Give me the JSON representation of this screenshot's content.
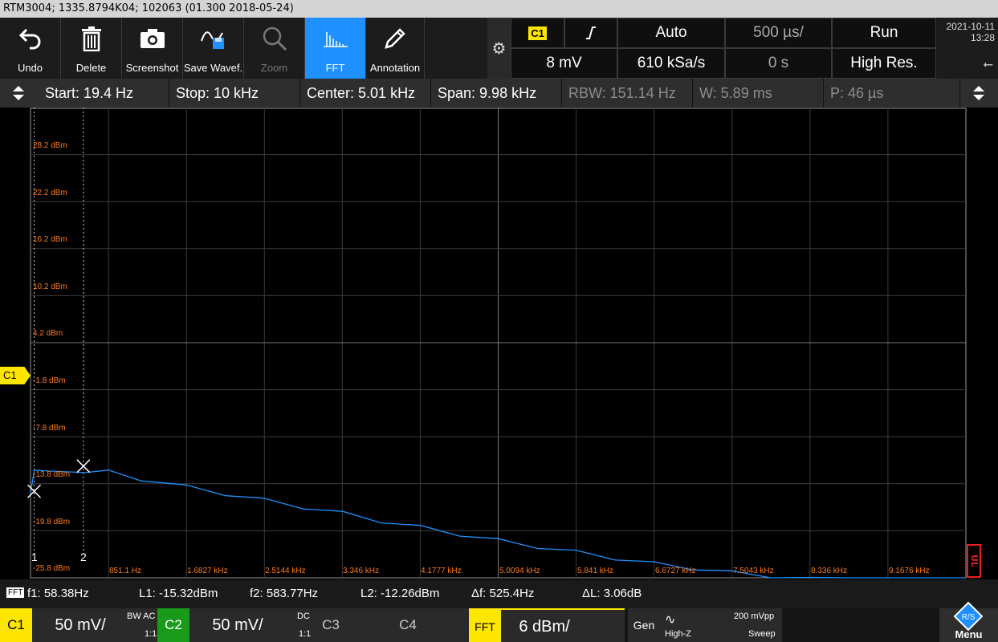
{
  "title": "RTM3004; 1335.8794K04; 102063 (01.300 2018-05-24)",
  "toolbar": {
    "undo": "Undo",
    "delete": "Delete",
    "screenshot": "Screenshot",
    "save_waveform": "Save Wavef.",
    "zoom": "Zoom",
    "fft": "FFT",
    "annotation": "Annotation"
  },
  "acquisition": {
    "channel": "C1",
    "trigger_slope": "rising-edge-icon",
    "trigger_mode": "Auto",
    "timebase": "500 µs/",
    "run_state": "Run",
    "trigger_level": "8 mV",
    "sample_rate": "610 kSa/s",
    "horizontal_position": "0 s",
    "acq_mode": "High Res."
  },
  "datetime": {
    "date": "2021-10-11",
    "time": "13:28"
  },
  "fft_settings": {
    "start": "Start: 19.4 Hz",
    "stop": "Stop: 10 kHz",
    "center": "Center: 5.01 kHz",
    "span": "Span: 9.98 kHz",
    "rbw": "RBW: 151.14 Hz",
    "window": "W: 5.89 ms",
    "period": "P: 46 µs"
  },
  "plot": {
    "y_labels": [
      "28.2 dBm",
      "22.2 dBm",
      "16.2 dBm",
      "10.2 dBm",
      "4.2 dBm",
      "-1.8 dBm",
      "-7.8 dBm",
      "-13.8 dBm",
      "-19.8 dBm",
      "-25.8 dBm"
    ],
    "x_labels": [
      "851.1 Hz",
      "1.6827 kHz",
      "2.5144 kHz",
      "3.346 kHz",
      "4.1777 kHz",
      "5.0094 kHz",
      "5.841 kHz",
      "6.6727 kHz",
      "7.5043 kHz",
      "8.336 kHz",
      "9.1676 kHz"
    ],
    "channel_marker": "C1",
    "cursor1": "1",
    "cursor2": "2",
    "ul_marker": "UL",
    "trace_color": "#1e90ff",
    "label_color": "#ff7a1a"
  },
  "chart_data": {
    "type": "line",
    "title": "",
    "xlabel": "",
    "ylabel": "",
    "x_unit": "kHz",
    "y_unit": "dBm",
    "xlim": [
      0.0194,
      10
    ],
    "ylim": [
      -25.8,
      31.2
    ],
    "grid": true,
    "series": [
      {
        "x": [
          0.0194,
          0.06,
          0.2,
          0.4,
          0.6,
          0.851,
          1.2,
          1.68,
          2.1,
          2.51,
          2.93,
          3.35,
          3.76,
          4.18,
          4.6,
          5.01,
          5.43,
          5.84,
          6.26,
          6.67,
          7.09,
          7.5,
          7.92,
          8.34,
          8.75,
          9.17,
          9.6,
          10
        ],
        "y": [
          -15.3,
          -13.0,
          -12.6,
          -13.2,
          -12.8,
          -13.0,
          -13.8,
          -14.8,
          -15.6,
          -16.4,
          -17.2,
          -18.0,
          -18.9,
          -19.7,
          -20.5,
          -21.3,
          -22.0,
          -22.7,
          -23.4,
          -24.1,
          -24.6,
          -25.2,
          -25.6,
          -26.0,
          -26.3,
          -26.6,
          -26.8,
          -27.0
        ]
      }
    ],
    "cursors": {
      "f1": 58.38,
      "f2": 583.77
    }
  },
  "measurements": {
    "tag": "FFT",
    "f1": "f1: 58.38Hz",
    "l1": "L1: -15.32dBm",
    "f2": "f2: 583.77Hz",
    "l2": "L2: -12.26dBm",
    "df": "Δf: 525.4Hz",
    "dl": "ΔL: 3.06dB"
  },
  "channels": {
    "c1": {
      "name": "C1",
      "scale": "50 mV/",
      "bw": "BW AC",
      "ratio": "1:1",
      "color": "#ffe600"
    },
    "c2": {
      "name": "C2",
      "scale": "50 mV/",
      "coupling": "DC",
      "ratio": "1:1",
      "color": "#1a9a1a"
    },
    "c3": {
      "name": "C3"
    },
    "c4": {
      "name": "C4"
    },
    "fft": {
      "name": "FFT",
      "scale": "6 dBm/"
    },
    "gen": {
      "name": "Gen",
      "impedance": "High-Z",
      "amplitude": "200 mVpp",
      "mode": "Sweep"
    },
    "menu": "Menu"
  }
}
